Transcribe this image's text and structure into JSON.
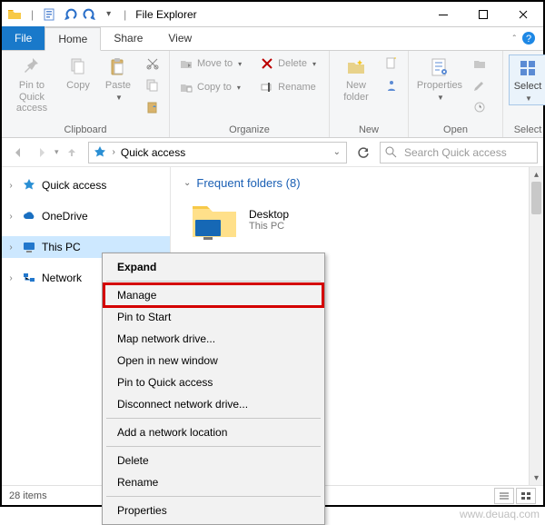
{
  "titlebar": {
    "app_title": "File Explorer"
  },
  "tabs": {
    "file": "File",
    "home": "Home",
    "share": "Share",
    "view": "View"
  },
  "ribbon": {
    "clipboard": {
      "pin": "Pin to Quick\naccess",
      "copy": "Copy",
      "paste": "Paste",
      "label": "Clipboard"
    },
    "organize": {
      "move_to": "Move to",
      "copy_to": "Copy to",
      "delete": "Delete",
      "rename": "Rename",
      "label": "Organize"
    },
    "new": {
      "new_folder": "New\nfolder",
      "label": "New"
    },
    "open": {
      "properties": "Properties",
      "label": "Open"
    },
    "select": {
      "select": "Select",
      "label": "Select"
    }
  },
  "address": {
    "location": "Quick access",
    "search_placeholder": "Search Quick access"
  },
  "nav": {
    "quick_access": "Quick access",
    "onedrive": "OneDrive",
    "this_pc": "This PC",
    "network": "Network"
  },
  "content": {
    "section_title": "Frequent folders (8)",
    "item": {
      "name": "Desktop",
      "location": "This PC"
    }
  },
  "context_menu": {
    "expand": "Expand",
    "manage": "Manage",
    "pin_to_start": "Pin to Start",
    "map_drive": "Map network drive...",
    "open_new_window": "Open in new window",
    "pin_quick": "Pin to Quick access",
    "disconnect": "Disconnect network drive...",
    "add_net_loc": "Add a network location",
    "delete": "Delete",
    "rename": "Rename",
    "properties": "Properties"
  },
  "status": {
    "count": "28 items"
  },
  "watermark": "www.deuaq.com"
}
